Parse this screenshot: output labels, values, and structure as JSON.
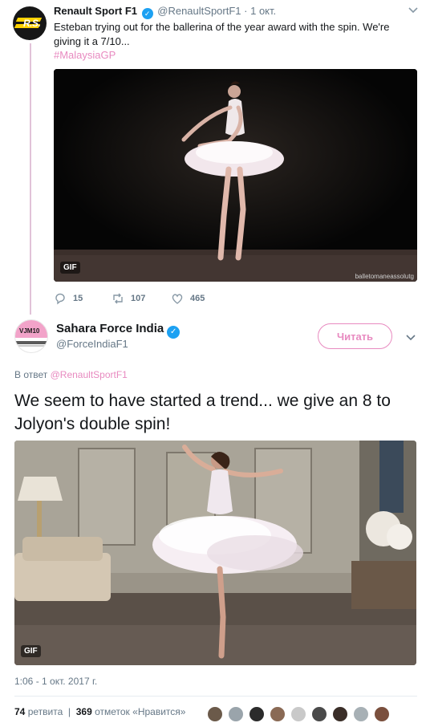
{
  "parent_tweet": {
    "name": "Renault Sport F1",
    "handle": "@RenaultSportF1",
    "dot": "·",
    "date": "1 окт.",
    "text": "Esteban trying out for the ballerina of the year award with the spin. We're giving it a 7/10...",
    "hashtag": "#MalaysiaGP",
    "media": {
      "badge": "GIF",
      "watermark": "balletomaneassolutg"
    },
    "actions": {
      "replies": "15",
      "retweets": "107",
      "likes": "465"
    },
    "avatar_icon": "renault-rs-logo-icon"
  },
  "main_tweet": {
    "name": "Sahara Force India",
    "handle": "@ForceIndiaF1",
    "follow_label": "Читать",
    "reply_prefix": "В ответ",
    "reply_mention": "@RenaultSportF1",
    "text": "We seem to have started a trend... we give an 8 to Jolyon's double spin!",
    "media": {
      "badge": "GIF"
    },
    "timestamp": "1:06 - 1 окт. 2017 г.",
    "stats": {
      "retweets_count": "74",
      "retweets_label": "ретвита",
      "likes_count": "369",
      "likes_label": "отметок «Нравится»"
    },
    "avatar_icon": "force-india-vjm10-logo-icon",
    "avatar_text": "VJM10"
  },
  "colors": {
    "accent": "#e88ac0",
    "verified": "#1da1f2",
    "muted": "#657786",
    "thread_line": "#e1c2d8"
  },
  "likers": [
    "#6b5a4a",
    "#9aa4ab",
    "#2b2b2b",
    "#8a6a55",
    "#c9c9c9",
    "#4a4a4a",
    "#3a2e28",
    "#a7b0b5",
    "#7a4f3d"
  ]
}
